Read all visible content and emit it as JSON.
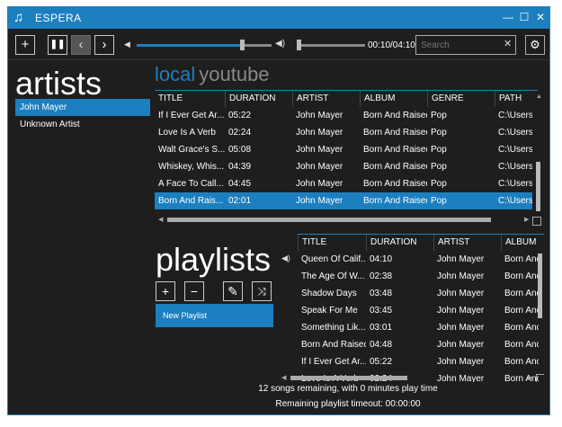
{
  "window": {
    "title": "ESPERA",
    "accent": "#1c7fc0"
  },
  "toolbar": {
    "time": "00:10/04:10",
    "search_placeholder": "Search",
    "playback_progress_pct": 77,
    "volume_pct": 2
  },
  "artists": {
    "title": "artists",
    "items": [
      "John Mayer",
      "Unknown Artist"
    ],
    "selected": "John Mayer"
  },
  "library_tabs": {
    "local": "local",
    "youtube": "youtube"
  },
  "songs": {
    "columns": [
      "TITLE",
      "DURATION",
      "ARTIST",
      "ALBUM",
      "GENRE",
      "PATH"
    ],
    "rows": [
      [
        "If I Ever Get Ar...",
        "05:22",
        "John Mayer",
        "Born And Raised",
        "Pop",
        "C:\\Users\\I"
      ],
      [
        "Love Is A Verb",
        "02:24",
        "John Mayer",
        "Born And Raised",
        "Pop",
        "C:\\Users\\I"
      ],
      [
        "Walt Grace's S...",
        "05:08",
        "John Mayer",
        "Born And Raised",
        "Pop",
        "C:\\Users\\I"
      ],
      [
        "Whiskey, Whis...",
        "04:39",
        "John Mayer",
        "Born And Raised",
        "Pop",
        "C:\\Users\\I"
      ],
      [
        "A Face To Call...",
        "04:45",
        "John Mayer",
        "Born And Raised",
        "Pop",
        "C:\\Users\\I"
      ],
      [
        "Born And Rais...",
        "02:01",
        "John Mayer",
        "Born And Raised",
        "Pop",
        "C:\\Users\\I"
      ]
    ]
  },
  "playlists": {
    "title": "playlists",
    "items": [
      "New Playlist"
    ]
  },
  "playlist_songs": {
    "columns": [
      "TITLE",
      "DURATION",
      "ARTIST",
      "ALBUM"
    ],
    "rows": [
      [
        "Queen Of Calif...",
        "04:10",
        "John Mayer",
        "Born And"
      ],
      [
        "The Age Of W...",
        "02:38",
        "John Mayer",
        "Born And"
      ],
      [
        "Shadow Days",
        "03:48",
        "John Mayer",
        "Born And"
      ],
      [
        "Speak For Me",
        "03:45",
        "John Mayer",
        "Born And"
      ],
      [
        "Something Lik...",
        "03:01",
        "John Mayer",
        "Born And"
      ],
      [
        "Born And Raised",
        "04:48",
        "John Mayer",
        "Born And"
      ],
      [
        "If I Ever Get Ar...",
        "05:22",
        "John Mayer",
        "Born And"
      ],
      [
        "Love Is A Verb",
        "02:24",
        "John Mayer",
        "Born And"
      ]
    ]
  },
  "status": {
    "remaining": "12 songs remaining, with 0 minutes play time",
    "timeout": "Remaining playlist timeout: 00:00:00"
  }
}
